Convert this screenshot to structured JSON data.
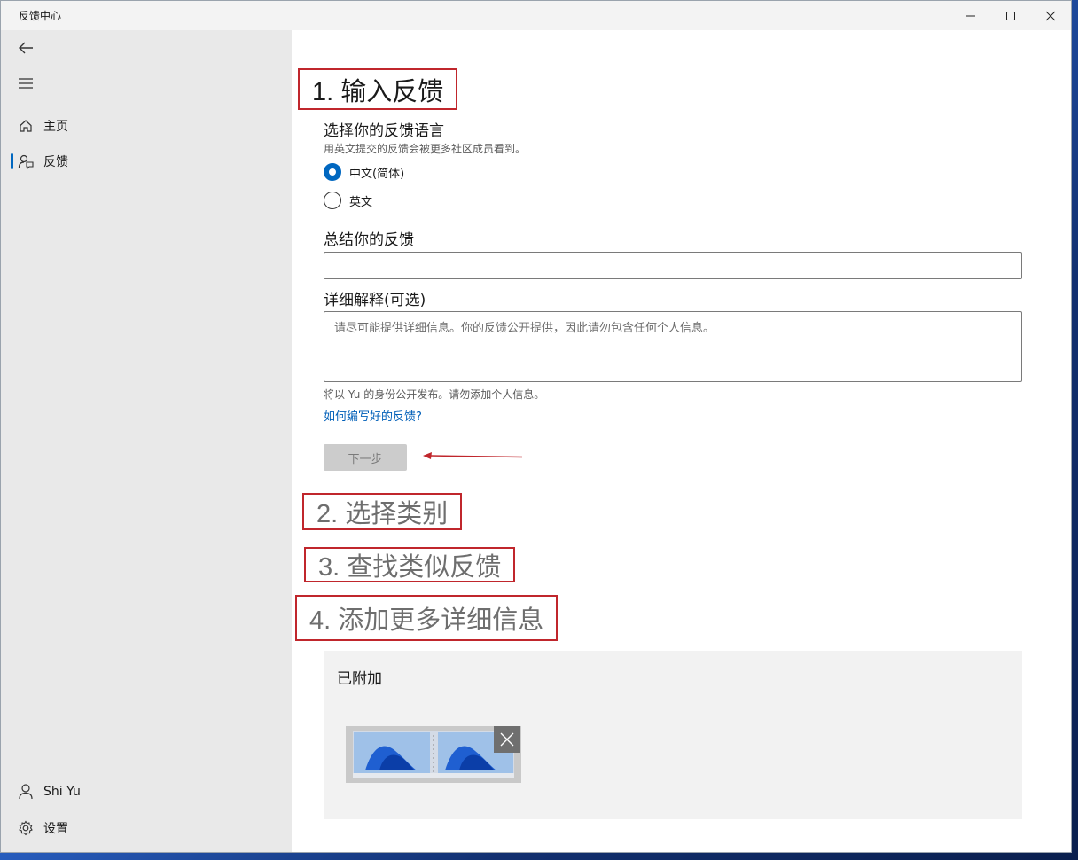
{
  "window": {
    "title": "反馈中心"
  },
  "sidebar": {
    "items": [
      {
        "label": "主页",
        "icon": "home-icon"
      },
      {
        "label": "反馈",
        "icon": "feedback-icon"
      }
    ],
    "user": {
      "label": "Shi Yu",
      "icon": "person-icon"
    },
    "settings": {
      "label": "设置",
      "icon": "gear-icon"
    }
  },
  "steps": [
    {
      "label": "1. 输入反馈",
      "state": "active"
    },
    {
      "label": "2. 选择类别",
      "state": "inactive"
    },
    {
      "label": "3. 查找类似反馈",
      "state": "inactive"
    },
    {
      "label": "4. 添加更多详细信息",
      "state": "inactive"
    }
  ],
  "form": {
    "language_heading": "选择你的反馈语言",
    "language_hint": "用英文提交的反馈会被更多社区成员看到。",
    "language_options": [
      {
        "label": "中文(简体)",
        "selected": true
      },
      {
        "label": "英文",
        "selected": false
      }
    ],
    "summary_heading": "总结你的反馈",
    "summary_value": "",
    "details_heading": "详细解释(可选)",
    "details_placeholder": "请尽可能提供详细信息。你的反馈公开提供，因此请勿包含任何个人信息。",
    "publish_note": "将以 Yu 的身份公开发布。请勿添加个人信息。",
    "help_link": "如何编写好的反馈?",
    "next_button": "下一步"
  },
  "attachments": {
    "heading": "已附加"
  },
  "colors": {
    "accent": "#0067c0",
    "annotation_red": "#c0262c"
  }
}
